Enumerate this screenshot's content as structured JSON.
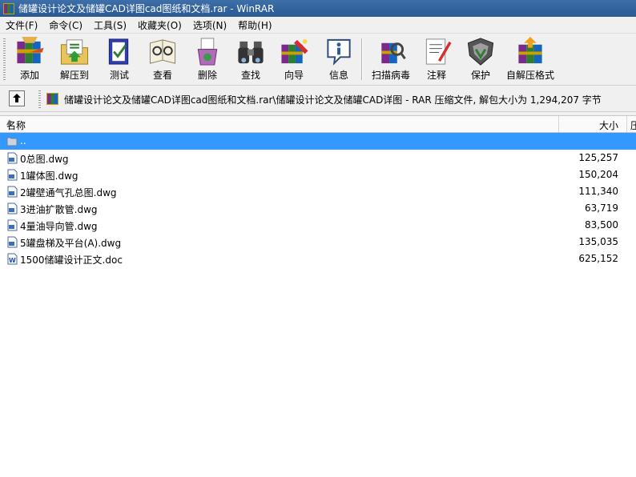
{
  "window": {
    "title": "储罐设计论文及储罐CAD详图cad图纸和文档.rar - WinRAR"
  },
  "menu": [
    "文件(F)",
    "命令(C)",
    "工具(S)",
    "收藏夹(O)",
    "选项(N)",
    "帮助(H)"
  ],
  "toolbar": {
    "add": "添加",
    "extract": "解压到",
    "test": "测试",
    "view": "查看",
    "delete": "删除",
    "find": "查找",
    "wizard": "向导",
    "info": "信息",
    "virusscan": "扫描病毒",
    "comment": "注释",
    "protect": "保护",
    "sfx": "自解压格式"
  },
  "address": {
    "path": "储罐设计论文及储罐CAD详图cad图纸和文档.rar\\储罐设计论文及储罐CAD详图 - RAR 压缩文件, 解包大小为 1,294,207 字节"
  },
  "columns": {
    "name": "名称",
    "size": "大小",
    "extra": "压"
  },
  "files": [
    {
      "name": "..",
      "size": "",
      "type": "folder",
      "selected": true
    },
    {
      "name": "0总图.dwg",
      "size": "125,257",
      "type": "dwg"
    },
    {
      "name": "1罐体图.dwg",
      "size": "150,204",
      "type": "dwg"
    },
    {
      "name": "2罐壁通气孔总图.dwg",
      "size": "111,340",
      "type": "dwg"
    },
    {
      "name": "3进油扩散管.dwg",
      "size": "63,719",
      "type": "dwg"
    },
    {
      "name": "4量油导向管.dwg",
      "size": "83,500",
      "type": "dwg"
    },
    {
      "name": "5罐盘梯及平台(A).dwg",
      "size": "135,035",
      "type": "dwg"
    },
    {
      "name": "1500储罐设计正文.doc",
      "size": "625,152",
      "type": "doc"
    }
  ],
  "colors": {
    "titlebar": "#2f5f99",
    "selection": "#3399ff"
  }
}
